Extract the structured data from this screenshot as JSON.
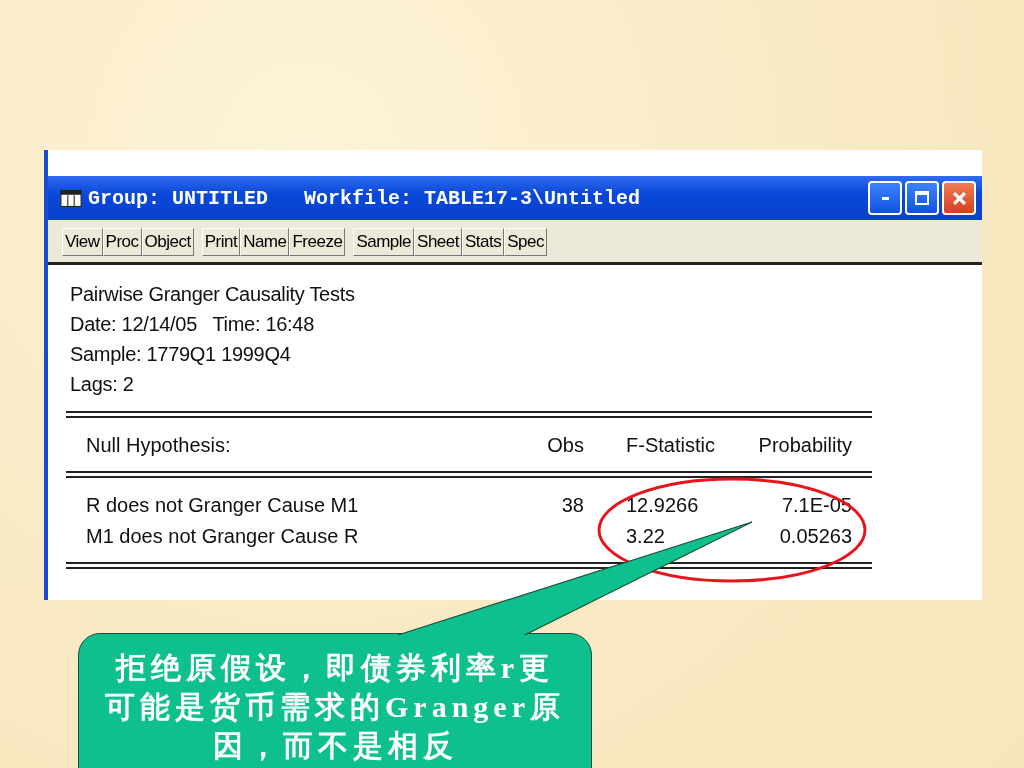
{
  "window": {
    "title": "Group: UNTITLED",
    "workfile": "Workfile: TABLE17-3\\Untitled"
  },
  "toolbar": [
    [
      "View",
      "Proc",
      "Object"
    ],
    [
      "Print",
      "Name",
      "Freeze"
    ],
    [
      "Sample",
      "Sheet",
      "Stats",
      "Spec"
    ]
  ],
  "header_lines": [
    "Pairwise Granger Causality Tests",
    "Date: 12/14/05   Time: 16:48",
    "Sample: 1779Q1 1999Q4",
    "Lags: 2"
  ],
  "table": {
    "columns": [
      "Null Hypothesis:",
      "Obs",
      "F-Statistic",
      "Probability"
    ],
    "rows": [
      [
        "R does not Granger Cause M1",
        "38",
        "12.9266",
        "7.1E-05"
      ],
      [
        "M1 does not Granger Cause R",
        "",
        "3.22",
        "0.05263"
      ]
    ]
  },
  "callout": {
    "text": "拒绝原假设，即债券利率r更可能是货币需求的Granger原因，而不是相反"
  }
}
